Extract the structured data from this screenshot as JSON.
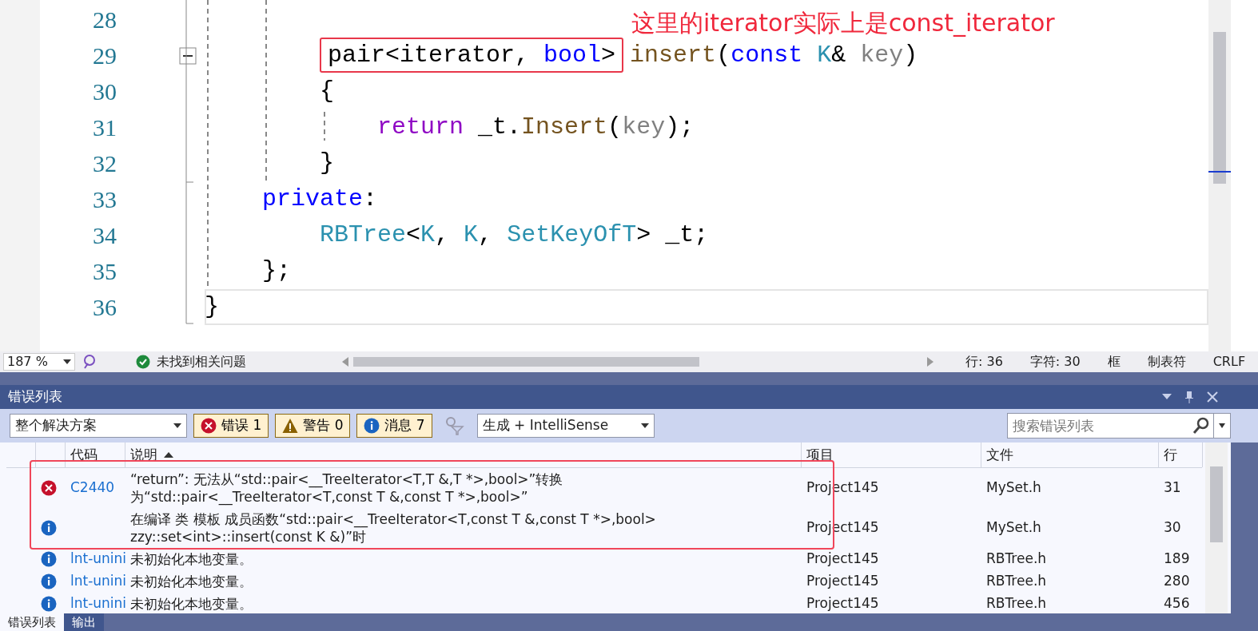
{
  "editor": {
    "annotation": "这里的iterator实际上是const_iterator",
    "lines": [
      {
        "children": [
          {
            "children": [
              {
                "number": "28"
              },
              {
                "number": "29",
                "fold_expanded": true,
                "tokens": [
                  {
                    "kind": "group",
                    "boxed": true,
                    "tokens": [
                      {
                        "kind": "plain",
                        "text": "pair<iterator, "
                      },
                      {
                        "kind": "kw",
                        "text": "bool"
                      },
                      {
                        "kind": "plain",
                        "text": ">"
                      }
                    ]
                  },
                  {
                    "kind": "func",
                    "text": " insert"
                  },
                  {
                    "kind": "plain",
                    "text": "("
                  },
                  {
                    "kind": "kw",
                    "text": "const"
                  },
                  {
                    "kind": "type",
                    "text": " K"
                  },
                  {
                    "kind": "plain",
                    "text": "& "
                  },
                  {
                    "kind": "param",
                    "text": "key"
                  },
                  {
                    "kind": "plain",
                    "text": ")"
                  }
                ]
              },
              {
                "number": "30",
                "tokens": [
                  {
                    "kind": "plain",
                    "text": "{"
                  }
                ]
              },
              {
                "children": [
                  {
                    "number": "31",
                    "tokens": [
                      {
                        "kind": "ctl",
                        "text": "return"
                      },
                      {
                        "kind": "plain",
                        "text": " _t."
                      },
                      {
                        "kind": "func",
                        "text": "Insert"
                      },
                      {
                        "kind": "plain",
                        "text": "("
                      },
                      {
                        "kind": "param",
                        "text": "key"
                      },
                      {
                        "kind": "plain",
                        "text": ");"
                      }
                    ]
                  }
                ]
              },
              {
                "number": "32",
                "tokens": [
                  {
                    "kind": "plain",
                    "text": "}"
                  }
                ]
              }
            ]
          },
          {
            "number": "33",
            "tokens": [
              {
                "kind": "kw",
                "text": "private"
              },
              {
                "kind": "plain",
                "text": ":"
              }
            ]
          },
          {
            "children": [
              {
                "number": "34",
                "tokens": [
                  {
                    "kind": "type",
                    "text": "RBTree"
                  },
                  {
                    "kind": "plain",
                    "text": "<"
                  },
                  {
                    "kind": "type",
                    "text": "K"
                  },
                  {
                    "kind": "plain",
                    "text": ", "
                  },
                  {
                    "kind": "type",
                    "text": "K"
                  },
                  {
                    "kind": "plain",
                    "text": ", "
                  },
                  {
                    "kind": "type",
                    "text": "SetKeyOfT"
                  },
                  {
                    "kind": "plain",
                    "text": "> _t;"
                  }
                ]
              }
            ]
          },
          {
            "number": "35",
            "tokens": [
              {
                "kind": "plain",
                "text": "};"
              }
            ]
          }
        ]
      },
      {
        "number": "36",
        "current": true,
        "tokens": [
          {
            "kind": "plain",
            "text": "}"
          }
        ]
      }
    ]
  },
  "status_bar": {
    "zoom": "187 %",
    "issues": "未找到相关问题",
    "items": [
      "行: 36",
      "字符: 30",
      "框",
      "制表符",
      "CRLF"
    ]
  },
  "error_list": {
    "title": "错误列表",
    "scope": "整个解决方案",
    "filters": [
      {
        "kind": "error",
        "label": "错误 1",
        "selected": true
      },
      {
        "kind": "warning",
        "label": "警告 0",
        "selected": true
      },
      {
        "kind": "info",
        "label": "消息 7",
        "selected": true
      }
    ],
    "source": "生成 + IntelliSense",
    "search": {
      "placeholder": "搜索错误列表"
    },
    "columns": [
      "代码",
      "说明",
      "项目",
      "文件",
      "行"
    ],
    "rows": [
      {
        "kind": "error",
        "code": "C2440",
        "description": "“return”: 无法从“std::pair<__TreeIterator<T,T &,T *>,bool>”转换为“std::pair<__TreeIterator<T,const T &,const T *>,bool>”",
        "project": "Project145",
        "file": "MySet.h",
        "line": "31",
        "annotated": true
      },
      {
        "kind": "info",
        "description": "在编译 类 模板 成员函数“std::pair<__TreeIterator<T,const T &,const T *>,bool> zzy::set<int>::insert(const K &)”时",
        "project": "Project145",
        "file": "MySet.h",
        "line": "30",
        "annotated": true
      },
      {
        "kind": "info",
        "code": "lnt-unini",
        "description": "未初始化本地变量。",
        "project": "Project145",
        "file": "RBTree.h",
        "line": "189",
        "annotated": false
      },
      {
        "kind": "info",
        "code": "lnt-unini",
        "description": "未初始化本地变量。",
        "project": "Project145",
        "file": "RBTree.h",
        "line": "280",
        "annotated": false
      },
      {
        "kind": "info",
        "code": "lnt-unini",
        "description": "未初始化本地变量。",
        "project": "Project145",
        "file": "RBTree.h",
        "line": "456",
        "annotated": false
      }
    ]
  },
  "bottom_tabs": [
    {
      "label": "错误列表",
      "selected": true
    },
    {
      "label": "输出",
      "selected": false
    }
  ]
}
